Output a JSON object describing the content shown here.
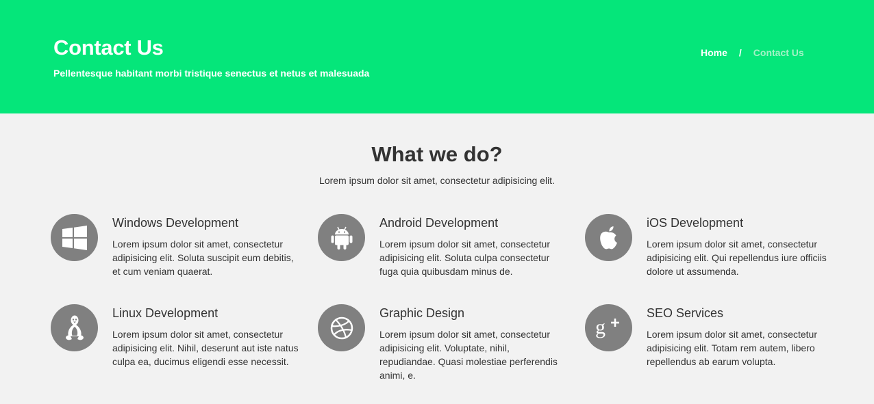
{
  "hero": {
    "title": "Contact Us",
    "subtitle": "Pellentesque habitant morbi tristique senectus et netus et malesuada",
    "breadcrumb": {
      "home": "Home",
      "separator": "/",
      "current": "Contact Us"
    },
    "background_color": "#05e67a"
  },
  "section": {
    "title": "What we do?",
    "subtitle": "Lorem ipsum dolor sit amet, consectetur adipisicing elit."
  },
  "services": [
    {
      "icon": "windows-icon",
      "title": "Windows Development",
      "text": "Lorem ipsum dolor sit amet, consectetur adipisicing elit. Soluta suscipit eum debitis, et cum veniam quaerat."
    },
    {
      "icon": "android-icon",
      "title": "Android Development",
      "text": "Lorem ipsum dolor sit amet, consectetur adipisicing elit. Soluta culpa consectetur fuga quia quibusdam minus de."
    },
    {
      "icon": "apple-icon",
      "title": "iOS Development",
      "text": "Lorem ipsum dolor sit amet, consectetur adipisicing elit. Qui repellendus iure officiis dolore ut assumenda."
    },
    {
      "icon": "linux-icon",
      "title": "Linux Development",
      "text": "Lorem ipsum dolor sit amet, consectetur adipisicing elit. Nihil, deserunt aut iste natus culpa ea, ducimus eligendi esse necessit."
    },
    {
      "icon": "dribbble-icon",
      "title": "Graphic Design",
      "text": "Lorem ipsum dolor sit amet, consectetur adipisicing elit. Voluptate, nihil, repudiandae. Quasi molestiae perferendis animi, e."
    },
    {
      "icon": "google-plus-icon",
      "title": "SEO Services",
      "text": "Lorem ipsum dolor sit amet, consectetur adipisicing elit. Totam rem autem, libero repellendus ab earum volupta."
    }
  ]
}
